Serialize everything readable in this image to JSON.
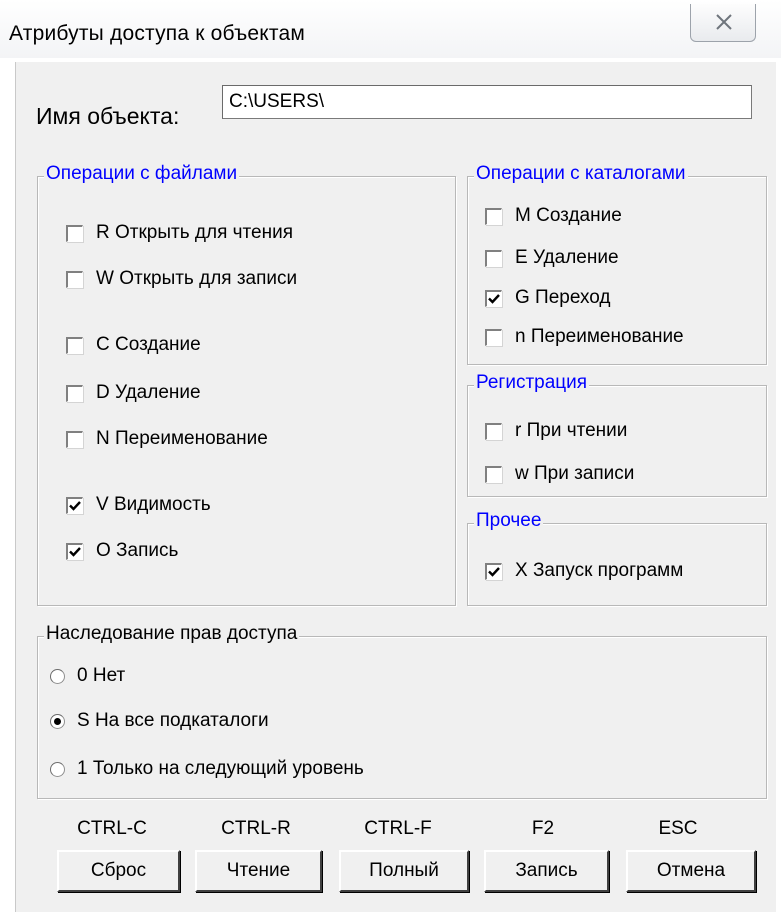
{
  "window": {
    "title": "Атрибуты доступа к объектам",
    "close_icon": "close-icon"
  },
  "object_name": {
    "label": "Имя объекта:",
    "value": "C:\\USERS\\"
  },
  "file_ops": {
    "legend": "Операции с файлами",
    "items": [
      {
        "label": "R Открыть для чтения",
        "checked": false
      },
      {
        "label": "W Открыть для записи",
        "checked": false
      },
      {
        "label": "C Создание",
        "checked": false
      },
      {
        "label": "D Удаление",
        "checked": false
      },
      {
        "label": "N Переименование",
        "checked": false
      },
      {
        "label": "V Видимость",
        "checked": true
      },
      {
        "label": "O Запись",
        "checked": true
      }
    ]
  },
  "dir_ops": {
    "legend": "Операции с каталогами",
    "items": [
      {
        "label": "M Создание",
        "checked": false
      },
      {
        "label": "E Удаление",
        "checked": false
      },
      {
        "label": "G Переход",
        "checked": true
      },
      {
        "label": "n Переименование",
        "checked": false
      }
    ]
  },
  "registration": {
    "legend": "Регистрация",
    "items": [
      {
        "label": "r При чтении",
        "checked": false
      },
      {
        "label": "w При записи",
        "checked": false
      }
    ]
  },
  "other": {
    "legend": "Прочее",
    "items": [
      {
        "label": "X Запуск программ",
        "checked": true
      }
    ]
  },
  "inheritance": {
    "legend": "Наследование прав доступа",
    "options": [
      {
        "label": "0 Нет",
        "selected": false
      },
      {
        "label": "S На все подкаталоги",
        "selected": true
      },
      {
        "label": "1 Только на следующий уровень",
        "selected": false
      }
    ]
  },
  "buttons": [
    {
      "hotkey": "CTRL-C",
      "label": "Сброс"
    },
    {
      "hotkey": "CTRL-R",
      "label": "Чтение"
    },
    {
      "hotkey": "CTRL-F",
      "label": "Полный"
    },
    {
      "hotkey": "F2",
      "label": "Запись"
    },
    {
      "hotkey": "ESC",
      "label": "Отмена"
    }
  ],
  "colors": {
    "legend_blue": "#0000ff",
    "dialog_bg": "#f0f0f0"
  }
}
